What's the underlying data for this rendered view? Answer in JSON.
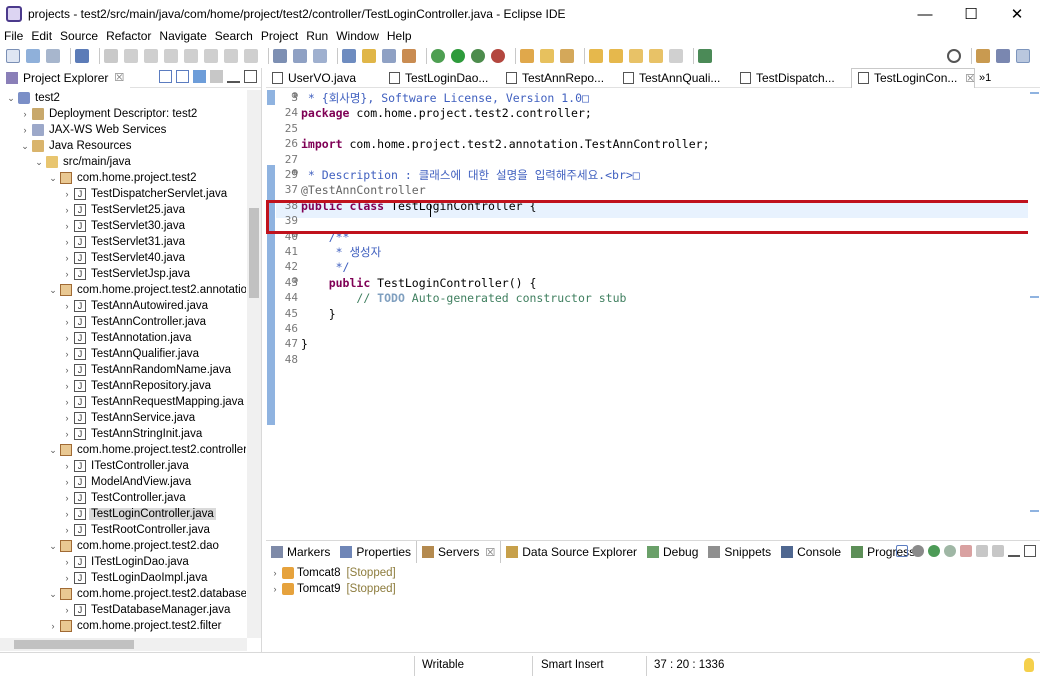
{
  "window": {
    "title": "projects - test2/src/main/java/com/home/project/test2/controller/TestLoginController.java - Eclipse IDE",
    "minimize": "—",
    "maximize": "☐",
    "close": "✕"
  },
  "menu": [
    "File",
    "Edit",
    "Source",
    "Refactor",
    "Navigate",
    "Search",
    "Project",
    "Run",
    "Window",
    "Help"
  ],
  "explorer": {
    "tab_label": "Project Explorer",
    "tab_close": "☒",
    "tree": [
      {
        "label": "test2",
        "icon": "project-icon",
        "indent": 0,
        "twisty": "⌄"
      },
      {
        "label": "Deployment Descriptor: test2",
        "icon": "descriptor-icon",
        "indent": 1,
        "twisty": "›"
      },
      {
        "label": "JAX-WS Web Services",
        "icon": "webservice-icon",
        "indent": 1,
        "twisty": "›"
      },
      {
        "label": "Java Resources",
        "icon": "java-resources-icon",
        "indent": 1,
        "twisty": "⌄"
      },
      {
        "label": "src/main/java",
        "icon": "source-folder-icon",
        "indent": 2,
        "twisty": "⌄"
      },
      {
        "label": "com.home.project.test2",
        "icon": "package-icon",
        "indent": 3,
        "twisty": "⌄"
      },
      {
        "label": "TestDispatcherServlet.java",
        "icon": "java-file-icon",
        "indent": 4,
        "twisty": "›"
      },
      {
        "label": "TestServlet25.java",
        "icon": "java-file-icon",
        "indent": 4,
        "twisty": "›"
      },
      {
        "label": "TestServlet30.java",
        "icon": "java-file-icon",
        "indent": 4,
        "twisty": "›"
      },
      {
        "label": "TestServlet31.java",
        "icon": "java-file-icon",
        "indent": 4,
        "twisty": "›"
      },
      {
        "label": "TestServlet40.java",
        "icon": "java-file-icon",
        "indent": 4,
        "twisty": "›"
      },
      {
        "label": "TestServletJsp.java",
        "icon": "java-file-icon",
        "indent": 4,
        "twisty": "›"
      },
      {
        "label": "com.home.project.test2.annotation",
        "icon": "package-icon",
        "indent": 3,
        "twisty": "⌄"
      },
      {
        "label": "TestAnnAutowired.java",
        "icon": "java-file-icon",
        "indent": 4,
        "twisty": "›"
      },
      {
        "label": "TestAnnController.java",
        "icon": "java-file-icon",
        "indent": 4,
        "twisty": "›"
      },
      {
        "label": "TestAnnotation.java",
        "icon": "java-file-icon",
        "indent": 4,
        "twisty": "›"
      },
      {
        "label": "TestAnnQualifier.java",
        "icon": "java-file-icon",
        "indent": 4,
        "twisty": "›"
      },
      {
        "label": "TestAnnRandomName.java",
        "icon": "java-file-icon",
        "indent": 4,
        "twisty": "›"
      },
      {
        "label": "TestAnnRepository.java",
        "icon": "java-file-icon",
        "indent": 4,
        "twisty": "›"
      },
      {
        "label": "TestAnnRequestMapping.java",
        "icon": "java-file-icon",
        "indent": 4,
        "twisty": "›"
      },
      {
        "label": "TestAnnService.java",
        "icon": "java-file-icon",
        "indent": 4,
        "twisty": "›"
      },
      {
        "label": "TestAnnStringInit.java",
        "icon": "java-file-icon",
        "indent": 4,
        "twisty": "›"
      },
      {
        "label": "com.home.project.test2.controller",
        "icon": "package-icon",
        "indent": 3,
        "twisty": "⌄"
      },
      {
        "label": "ITestController.java",
        "icon": "java-file-icon",
        "indent": 4,
        "twisty": "›"
      },
      {
        "label": "ModelAndView.java",
        "icon": "java-file-icon",
        "indent": 4,
        "twisty": "›"
      },
      {
        "label": "TestController.java",
        "icon": "java-file-icon",
        "indent": 4,
        "twisty": "›"
      },
      {
        "label": "TestLoginController.java",
        "icon": "java-file-icon",
        "indent": 4,
        "twisty": "›",
        "selected": true
      },
      {
        "label": "TestRootController.java",
        "icon": "java-file-icon",
        "indent": 4,
        "twisty": "›"
      },
      {
        "label": "com.home.project.test2.dao",
        "icon": "package-icon",
        "indent": 3,
        "twisty": "⌄"
      },
      {
        "label": "ITestLoginDao.java",
        "icon": "java-file-icon",
        "indent": 4,
        "twisty": "›"
      },
      {
        "label": "TestLoginDaoImpl.java",
        "icon": "java-file-icon",
        "indent": 4,
        "twisty": "›"
      },
      {
        "label": "com.home.project.test2.database",
        "icon": "package-icon",
        "indent": 3,
        "twisty": "⌄"
      },
      {
        "label": "TestDatabaseManager.java",
        "icon": "java-file-icon",
        "indent": 4,
        "twisty": "›"
      },
      {
        "label": "com.home.project.test2.filter",
        "icon": "package-icon",
        "indent": 3,
        "twisty": "›"
      }
    ]
  },
  "editor": {
    "tabs": [
      {
        "label": "UserVO.java",
        "active": false
      },
      {
        "label": "TestLoginDao...",
        "active": false
      },
      {
        "label": "TestAnnRepo...",
        "active": false
      },
      {
        "label": "TestAnnQuali...",
        "active": false
      },
      {
        "label": "TestDispatch...",
        "active": false
      },
      {
        "label": "TestLoginCon...",
        "active": true
      }
    ],
    "tab_close": "☒",
    "more_tabs": "»1",
    "lines": [
      {
        "num": "3",
        "fold": "⊕",
        "html": "<span class=\"cm\"> * {회사명}, Software License, Version 1.0□</span>"
      },
      {
        "num": "24",
        "fold": "",
        "html": "<span class=\"kw\">package</span> com.home.project.test2.controller;"
      },
      {
        "num": "25",
        "fold": "",
        "html": ""
      },
      {
        "num": "26",
        "fold": "",
        "html": "<span class=\"kw\">import</span> com.home.project.test2.annotation.TestAnnController;"
      },
      {
        "num": "27",
        "fold": "",
        "html": ""
      },
      {
        "num": "29",
        "fold": "⊕",
        "html": "<span class=\"cm\"> * Description : 클래스에 대한 설명을 입력해주세요.&lt;br&gt;□</span>"
      },
      {
        "num": "37",
        "fold": "",
        "html": "<span class=\"ann\">@TestAnnController</span>"
      },
      {
        "num": "38",
        "fold": "",
        "html": "<span class=\"kw\">public</span> <span class=\"kw\">class</span> TestLoginController {"
      },
      {
        "num": "39",
        "fold": "",
        "html": ""
      },
      {
        "num": "40",
        "fold": "⊖",
        "html": "    <span class=\"cm\">/**</span>"
      },
      {
        "num": "41",
        "fold": "",
        "html": "<span class=\"cm\">     * 생성자</span>"
      },
      {
        "num": "42",
        "fold": "",
        "html": "<span class=\"cm\">     */</span>"
      },
      {
        "num": "43",
        "fold": "⊖",
        "html": "    <span class=\"kw\">public</span> TestLoginController() {"
      },
      {
        "num": "44",
        "fold": "",
        "html": "        <span class=\"cm2\">// </span><span class=\"todo\">TODO</span><span class=\"cm2\"> Auto-generated constructor stub</span>"
      },
      {
        "num": "45",
        "fold": "",
        "html": "    }"
      },
      {
        "num": "46",
        "fold": "",
        "html": ""
      },
      {
        "num": "47",
        "fold": "",
        "html": "}"
      },
      {
        "num": "48",
        "fold": "",
        "html": ""
      }
    ]
  },
  "bottom_panel": {
    "tabs": [
      {
        "label": "Markers",
        "icon": "markers-icon",
        "active": false
      },
      {
        "label": "Properties",
        "icon": "properties-icon",
        "active": false
      },
      {
        "label": "Servers",
        "icon": "servers-icon",
        "active": true
      },
      {
        "label": "Data Source Explorer",
        "icon": "datasource-icon",
        "active": false
      },
      {
        "label": "Debug",
        "icon": "debug-icon",
        "active": false
      },
      {
        "label": "Snippets",
        "icon": "snippets-icon",
        "active": false
      },
      {
        "label": "Console",
        "icon": "console-icon",
        "active": false
      },
      {
        "label": "Progress",
        "icon": "progress-icon",
        "active": false
      }
    ],
    "servers": [
      {
        "name": "Tomcat8",
        "status": "[Stopped]"
      },
      {
        "name": "Tomcat9",
        "status": "[Stopped]"
      }
    ],
    "tab_close": "☒"
  },
  "statusbar": {
    "writable": "Writable",
    "insert_mode": "Smart Insert",
    "position": "37 : 20 : 1336"
  }
}
